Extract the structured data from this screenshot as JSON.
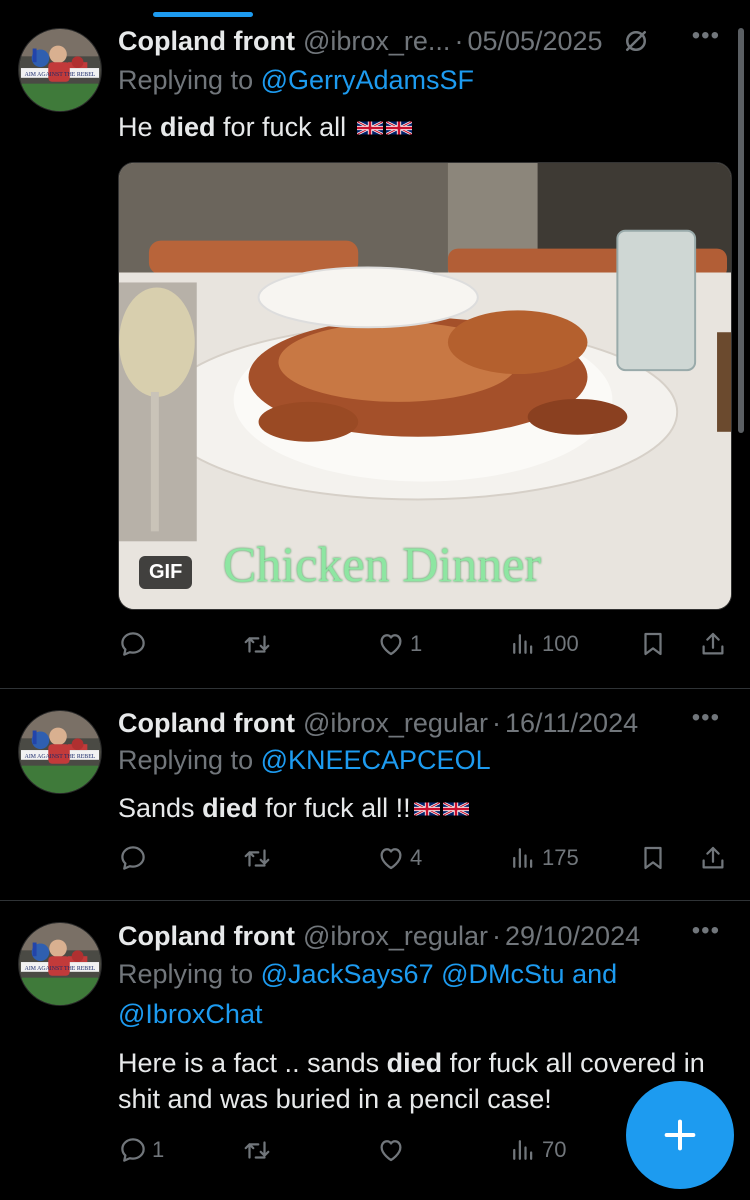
{
  "tweets": [
    {
      "author": "Copland front",
      "handle": "@ibrox_re...",
      "date": "05/05/2025",
      "replying_prefix": "Replying to",
      "mentions": [
        "@GerryAdamsSF"
      ],
      "text_before": "He ",
      "text_bold": "died",
      "text_after": " for fuck all ",
      "media": {
        "badge": "GIF",
        "caption": "Chicken Dinner"
      },
      "replies": "",
      "retweets": "",
      "likes": "1",
      "views": "100"
    },
    {
      "author": "Copland front",
      "handle": "@ibrox_regular",
      "date": "16/11/2024",
      "replying_prefix": "Replying to",
      "mentions": [
        "@KNEECAPCEOL"
      ],
      "text_before": "Sands ",
      "text_bold": "died",
      "text_after": " for fuck all !!",
      "replies": "",
      "retweets": "",
      "likes": "4",
      "views": "175"
    },
    {
      "author": "Copland front",
      "handle": "@ibrox_regular",
      "date": "29/10/2024",
      "replying_prefix": "Replying to",
      "mentions": [
        "@JackSays67",
        "@DMcStu",
        "@IbroxChat"
      ],
      "mention_joiner": "and",
      "text_before": "Here is a fact .. sands ",
      "text_bold": "died",
      "text_after": " for fuck all covered in shit and was buried in a pencil case!",
      "replies": "1",
      "retweets": "",
      "likes": "",
      "views": "70"
    }
  ],
  "avatar_banner_text": "AIM AGAINST THE REBEL",
  "icons": [
    "reply-icon",
    "retweet-icon",
    "like-icon",
    "views-icon",
    "bookmark-icon",
    "share-icon",
    "grok-icon",
    "more-icon",
    "compose-plus-icon"
  ],
  "colors": {
    "accent": "#1d9bf0",
    "muted": "#71767b",
    "text": "#e7e9ea",
    "divider": "#2f3336"
  }
}
